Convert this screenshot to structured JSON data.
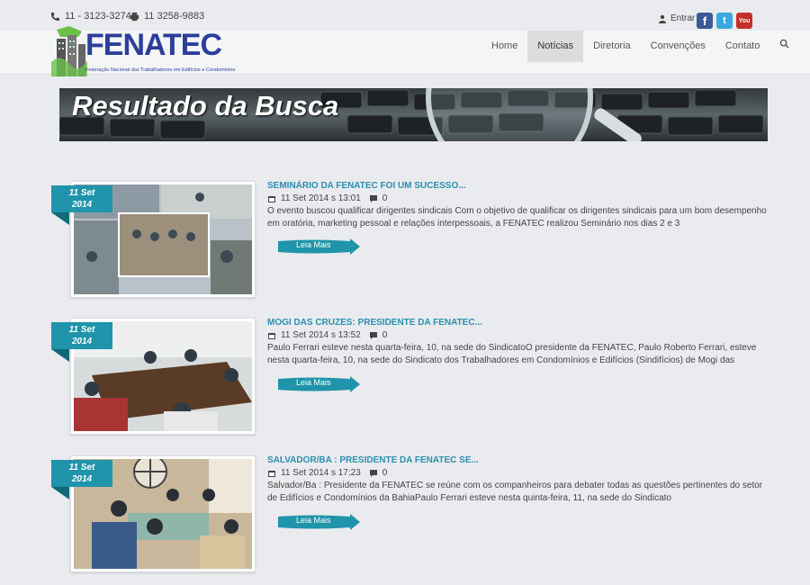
{
  "topbar": {
    "phone1": "11 - 3123-3274",
    "phone2": "11 3258-9883",
    "login_label": "Entrar",
    "social": [
      {
        "name": "facebook",
        "glyph": "f",
        "color": "#3b5998"
      },
      {
        "name": "twitter",
        "glyph": "t",
        "color": "#3aa9e0"
      },
      {
        "name": "youtube",
        "glyph": "You",
        "color": "#c4302b"
      }
    ]
  },
  "logo": {
    "word": "FENATEC",
    "subtitle": "Federação Nacional dos Trabalhadores em Edifícios e Condomínios"
  },
  "menu": [
    {
      "label": "Home"
    },
    {
      "label": "Notícias"
    },
    {
      "label": "Diretoria"
    },
    {
      "label": "Convenções"
    },
    {
      "label": "Contato"
    }
  ],
  "banner": {
    "title": "Resultado da Busca"
  },
  "articles": [
    {
      "day": "11 Set",
      "year": "2014",
      "title": "SEMINÁRIO DA FENATEC FOI UM SUCESSO...",
      "datetime": "11 Set 2014 s 13:01",
      "comments": "0",
      "excerpt": "O evento buscou qualificar dirigentes sindicais Com o objetivo de qualificar os dirigentes sindicais para um bom desempenho em oratória, marketing pessoal e relações interpessoais, a FENATEC realizou Seminário nos dias 2 e 3",
      "more": "Leia Mais"
    },
    {
      "day": "11 Set",
      "year": "2014",
      "title": "MOGI DAS CRUZES: PRESIDENTE DA FENATEC...",
      "datetime": "11 Set 2014 s 13:52",
      "comments": "0",
      "excerpt": "Paulo Ferrari esteve nesta quarta-feira, 10, na sede do SindicatoO presidente da FENATEC, Paulo Roberto Ferrari, esteve nesta quarta-feira, 10, na sede do Sindicato dos Trabalhadores em Condomínios e Edifícios (Sindifícios) de Mogi das",
      "more": "Leia Mais"
    },
    {
      "day": "11 Set",
      "year": "2014",
      "title": "SALVADOR/BA : PRESIDENTE DA FENATEC SE...",
      "datetime": "11 Set 2014 s 17:23",
      "comments": "0",
      "excerpt": "Salvador/Ba : Presidente da FENATEC se reúne com os companheiros  para  debater todas as questões pertinentes do setor de Edifícios e Condomínios da BahiaPaulo Ferrari esteve nesta quinta-feira, 11, na sede do Sindicato",
      "more": "Leia Mais"
    }
  ],
  "colors": {
    "accent": "#1f94aa",
    "title": "#2b8fb0",
    "brand": "#2c3e9a"
  }
}
